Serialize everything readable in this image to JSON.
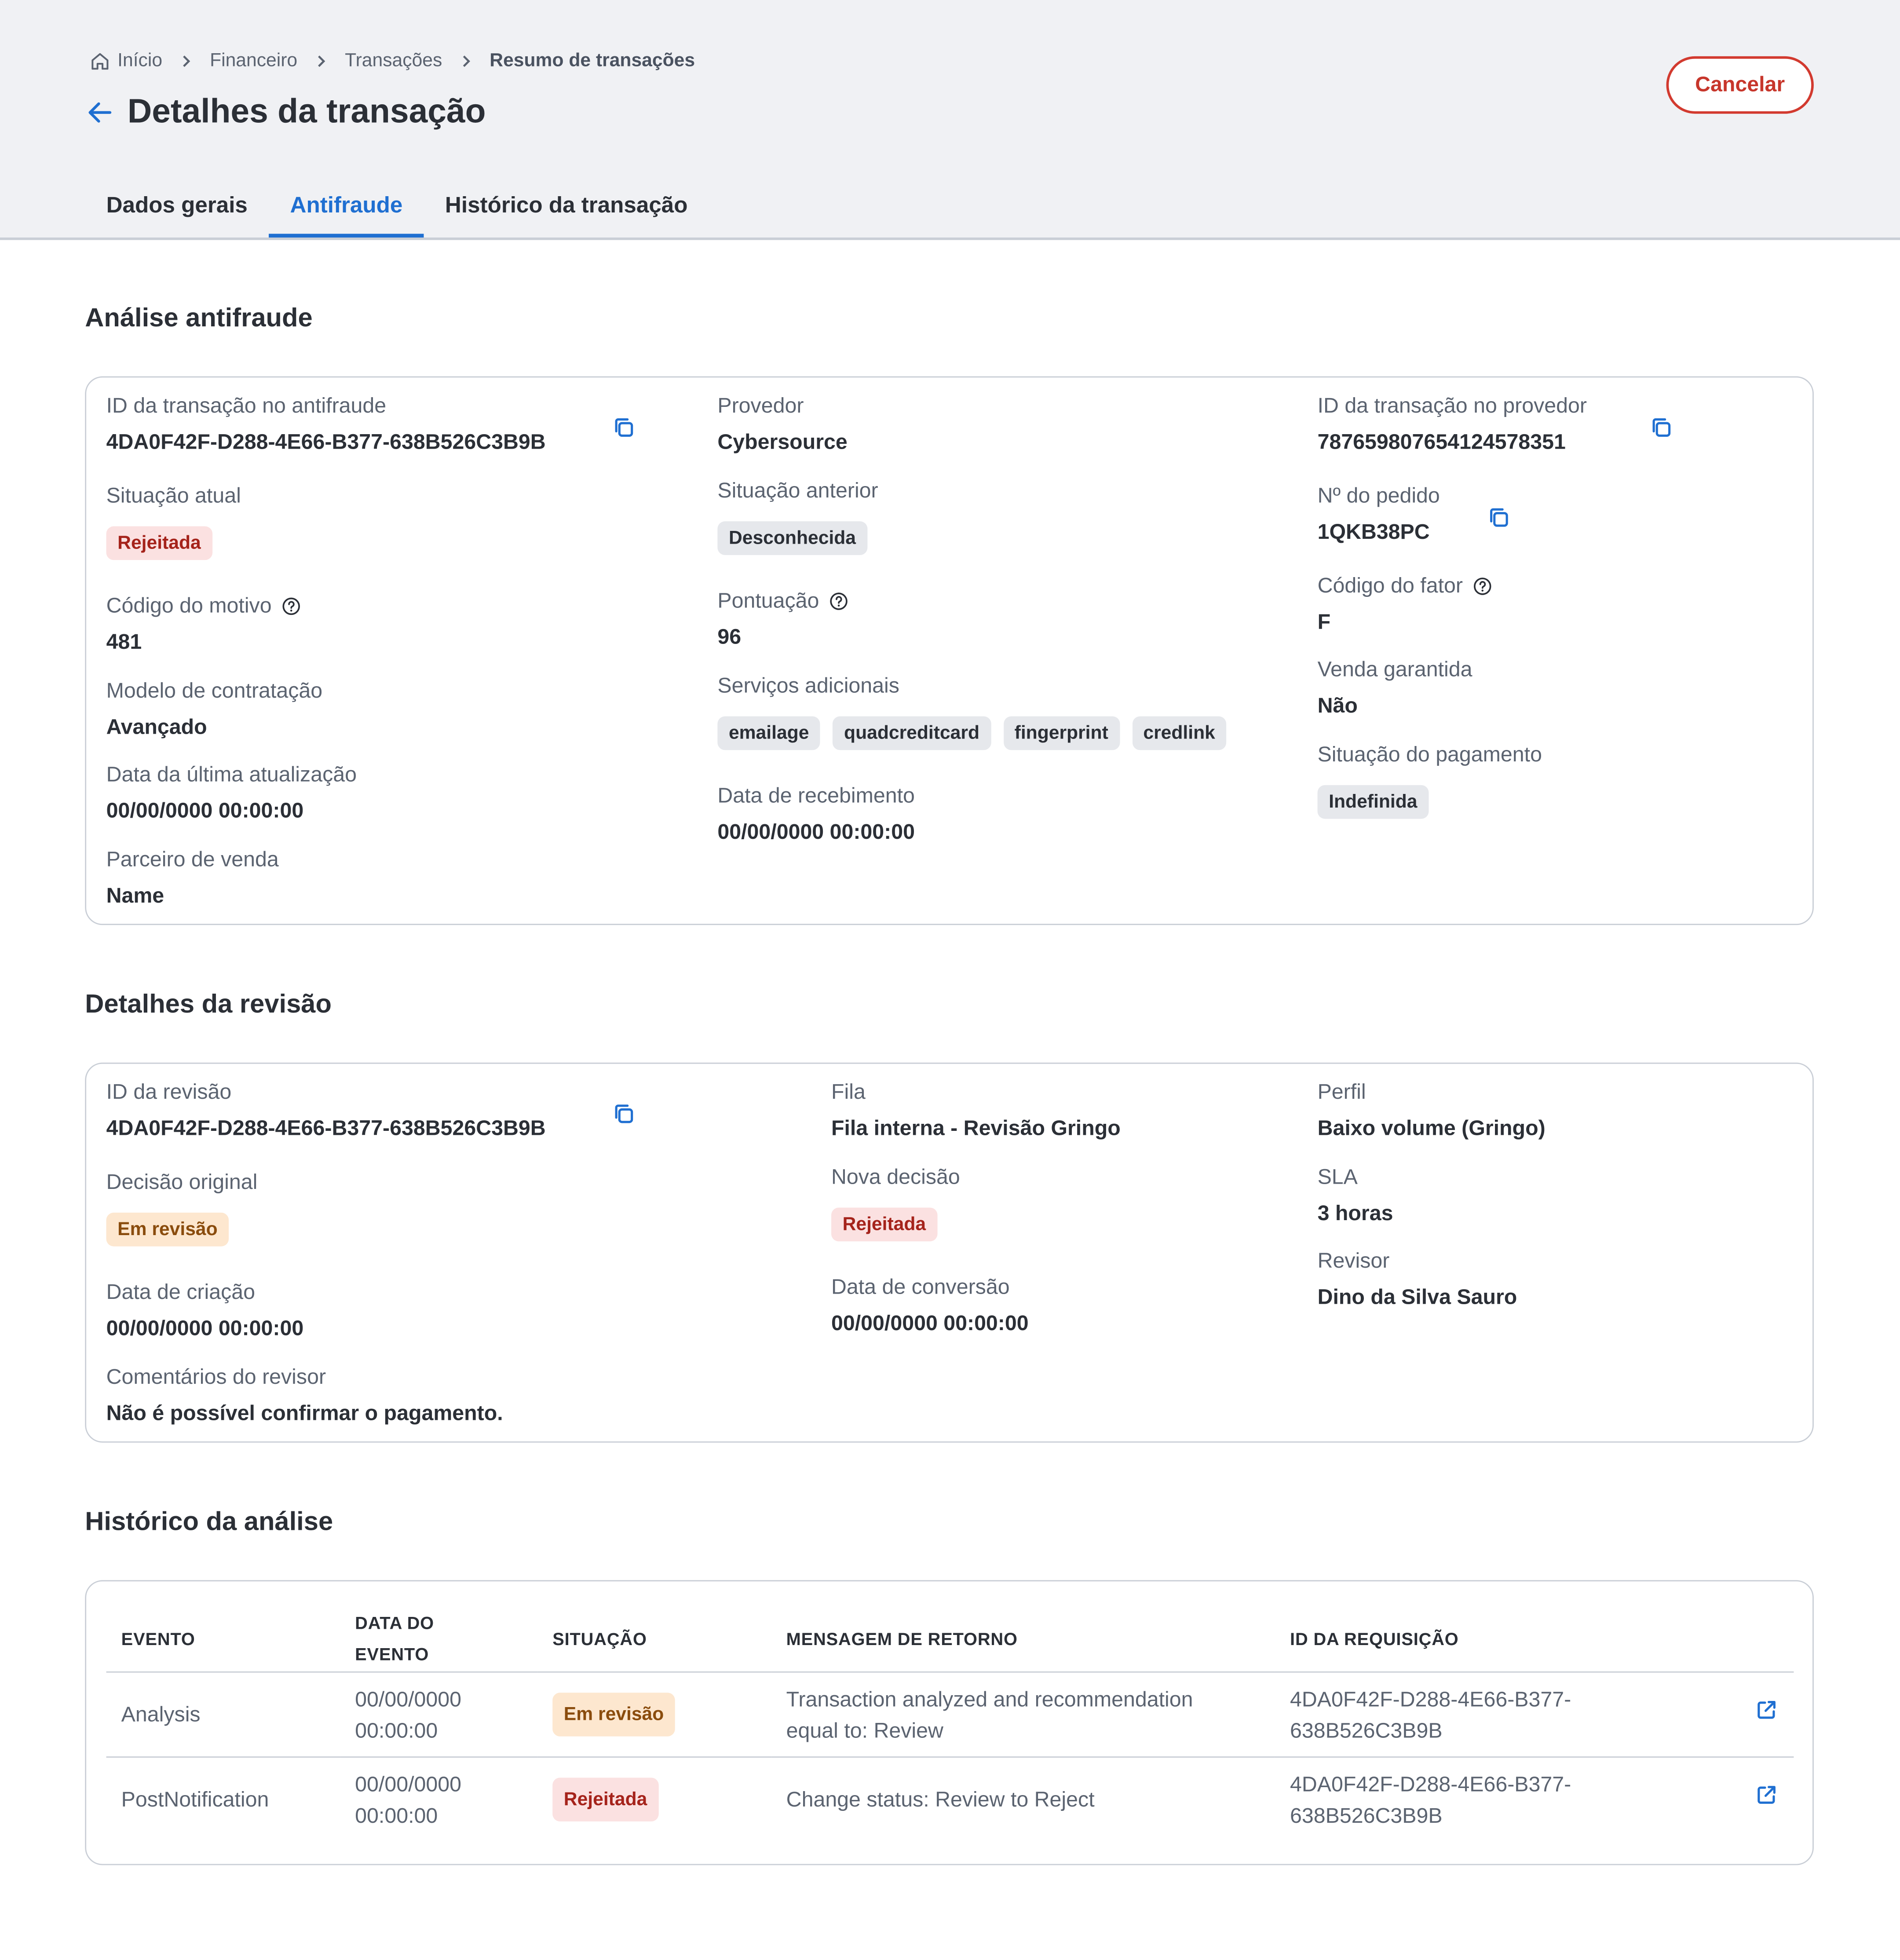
{
  "breadcrumb": {
    "home": "Início",
    "financeiro": "Financeiro",
    "transacoes": "Transações",
    "current": "Resumo de transações"
  },
  "header": {
    "title": "Detalhes da transação",
    "cancel_label": "Cancelar"
  },
  "tabs": [
    {
      "label": "Dados gerais"
    },
    {
      "label": "Antifraude"
    },
    {
      "label": "Histórico da transação"
    }
  ],
  "analise": {
    "title": "Análise antifraude",
    "id_antifraude": {
      "label": "ID da transação no antifraude",
      "value": "4DA0F42F-D288-4E66-B377-638B526C3B9B"
    },
    "situacao_atual": {
      "label": "Situação atual",
      "value": "Rejeitada"
    },
    "codigo_motivo": {
      "label": "Código do motivo",
      "value": "481"
    },
    "modelo": {
      "label": "Modelo de contratação",
      "value": "Avançado"
    },
    "ultima_atualizacao": {
      "label": "Data da última atualização",
      "value": "00/00/0000 00:00:00"
    },
    "parceiro": {
      "label": "Parceiro de venda",
      "value": "Name"
    },
    "provedor": {
      "label": "Provedor",
      "value": "Cybersource"
    },
    "situacao_anterior": {
      "label": "Situação anterior",
      "value": "Desconhecida"
    },
    "pontuacao": {
      "label": "Pontuação",
      "value": "96"
    },
    "servicos": {
      "label": "Serviços adicionais",
      "items": [
        "emailage",
        "quadcreditcard",
        "fingerprint",
        "credlink"
      ]
    },
    "recebimento": {
      "label": "Data de recebimento",
      "value": "00/00/0000 00:00:00"
    },
    "id_provedor": {
      "label": "ID da transação no provedor",
      "value": "787659807654124578351"
    },
    "pedido": {
      "label": "Nº do pedido",
      "value": "1QKB38PC"
    },
    "codigo_fator": {
      "label": "Código do fator",
      "value": "F"
    },
    "venda_garantida": {
      "label": "Venda garantida",
      "value": "Não"
    },
    "situacao_pagamento": {
      "label": "Situação do pagamento",
      "value": "Indefinida"
    }
  },
  "revisao": {
    "title": "Detalhes da revisão",
    "id_revisao": {
      "label": "ID da revisão",
      "value": "4DA0F42F-D288-4E66-B377-638B526C3B9B"
    },
    "decisao_original": {
      "label": "Decisão original",
      "value": "Em revisão"
    },
    "data_criacao": {
      "label": "Data de criação",
      "value": "00/00/0000 00:00:00"
    },
    "comentarios": {
      "label": "Comentários do revisor",
      "value": "Não é possível confirmar o pagamento."
    },
    "fila": {
      "label": "Fila",
      "value": "Fila interna - Revisão Gringo"
    },
    "nova_decisao": {
      "label": "Nova decisão",
      "value": "Rejeitada"
    },
    "data_conversao": {
      "label": "Data de conversão",
      "value": "00/00/0000 00:00:00"
    },
    "perfil": {
      "label": "Perfil",
      "value": "Baixo volume (Gringo)"
    },
    "sla": {
      "label": "SLA",
      "value": "3 horas"
    },
    "revisor": {
      "label": "Revisor",
      "value": "Dino da Silva Sauro"
    }
  },
  "historico": {
    "title": "Histórico da análise",
    "columns": {
      "evento": "EVENTO",
      "data_line1": "DATA DO",
      "data_line2": "EVENTO",
      "situacao": "SITUAÇÃO",
      "mensagem": "MENSAGEM DE RETORNO",
      "id": "ID DA REQUISIÇÃO"
    },
    "rows": [
      {
        "evento": "Analysis",
        "data_line1": "00/00/0000",
        "data_line2": "00:00:00",
        "situacao": "Em revisão",
        "mensagem_line1": "Transaction analyzed and recommendation",
        "mensagem_line2": "equal to: Review",
        "id_line1": "4DA0F42F-D288-4E66-B377-",
        "id_line2": "638B526C3B9B"
      },
      {
        "evento": "PostNotification",
        "data_line1": "00/00/0000",
        "data_line2": "00:00:00",
        "situacao": "Rejeitada",
        "mensagem_line1": "Change status: Review to Reject",
        "mensagem_line2": "",
        "id_line1": "4DA0F42F-D288-4E66-B377-",
        "id_line2": "638B526C3B9B"
      }
    ]
  }
}
